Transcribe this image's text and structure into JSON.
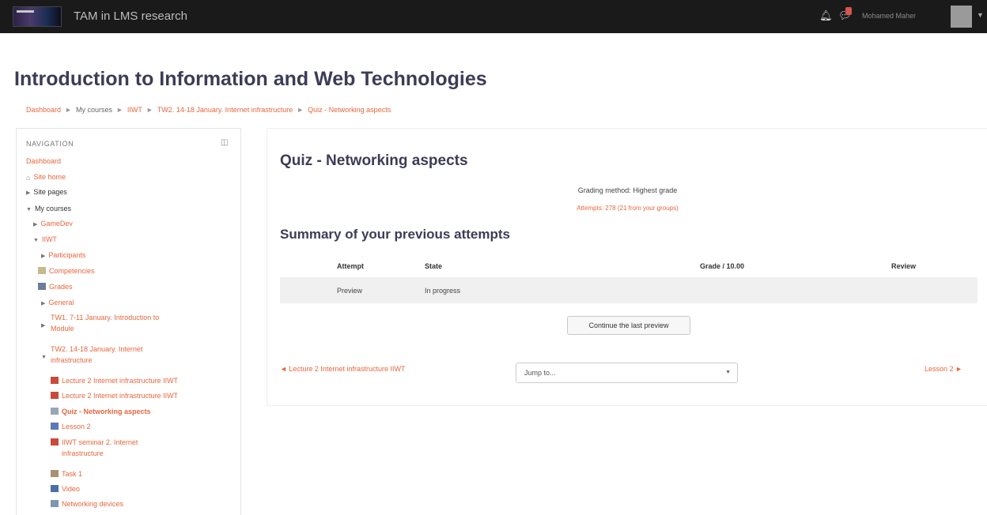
{
  "topbar": {
    "site_name": "TAM in LMS research",
    "user_name": "Mohamed Maher",
    "notification_badge_color": "#d9534f"
  },
  "page": {
    "title": "Introduction to Information and Web Technologies"
  },
  "breadcrumb": [
    "Dashboard",
    "My courses",
    "IIWT",
    "TW2. 14-18 January. Internet infrastructure",
    "Quiz - Networking aspects"
  ],
  "navigation": {
    "heading": "NAVIGATION",
    "items": [
      {
        "label": "Dashboard"
      },
      {
        "label": "Site home",
        "icon": "home-icon"
      },
      {
        "label": "Site pages"
      },
      {
        "label": "My courses"
      },
      {
        "label": "GameDev"
      },
      {
        "label": "IIWT"
      },
      {
        "label": "Participants"
      },
      {
        "label": "Competencies",
        "icon": "competencies-icon"
      },
      {
        "label": "Grades",
        "icon": "grades-icon"
      },
      {
        "label": "General"
      },
      {
        "label": "TW1. 7-11 January. Introduction to",
        "label2": "Module"
      },
      {
        "label": "TW2. 14-18 January. Internet",
        "label2": "infrastructure"
      },
      {
        "label": "Lecture 2 Internet infrastructure IIWT",
        "icon": "pdf-icon"
      },
      {
        "label": "Lecture 2 Internet infrastructure IIWT",
        "icon": "pdf-icon"
      },
      {
        "label": "Quiz - Networking aspects",
        "icon": "quiz-icon"
      },
      {
        "label": "Lesson 2",
        "icon": "lesson-icon"
      },
      {
        "label": "IIWT seminar 2. Internet",
        "label2": "infrastructure",
        "icon": "pdf-icon"
      },
      {
        "label": "Task 1",
        "icon": "task-icon"
      },
      {
        "label": "Video",
        "icon": "video-icon"
      },
      {
        "label": "Networking devices",
        "icon": "page-icon"
      }
    ]
  },
  "quiz": {
    "title": "Quiz - Networking aspects",
    "grading_method": "Grading method: Highest grade",
    "attempts": "Attempts: 278 (21 from your groups)",
    "summary_title": "Summary of your previous attempts",
    "table": {
      "headers": [
        "Attempt",
        "State",
        "Grade / 10.00",
        "Review"
      ],
      "rows": [
        [
          "Preview",
          "In progress",
          "",
          ""
        ]
      ]
    },
    "continue_button": "Continue the last preview",
    "prev_link": "◄ Lecture 2 Internet infrastructure IIWT",
    "jump_placeholder": "Jump to...",
    "next_link": "Lesson 2 ►"
  }
}
